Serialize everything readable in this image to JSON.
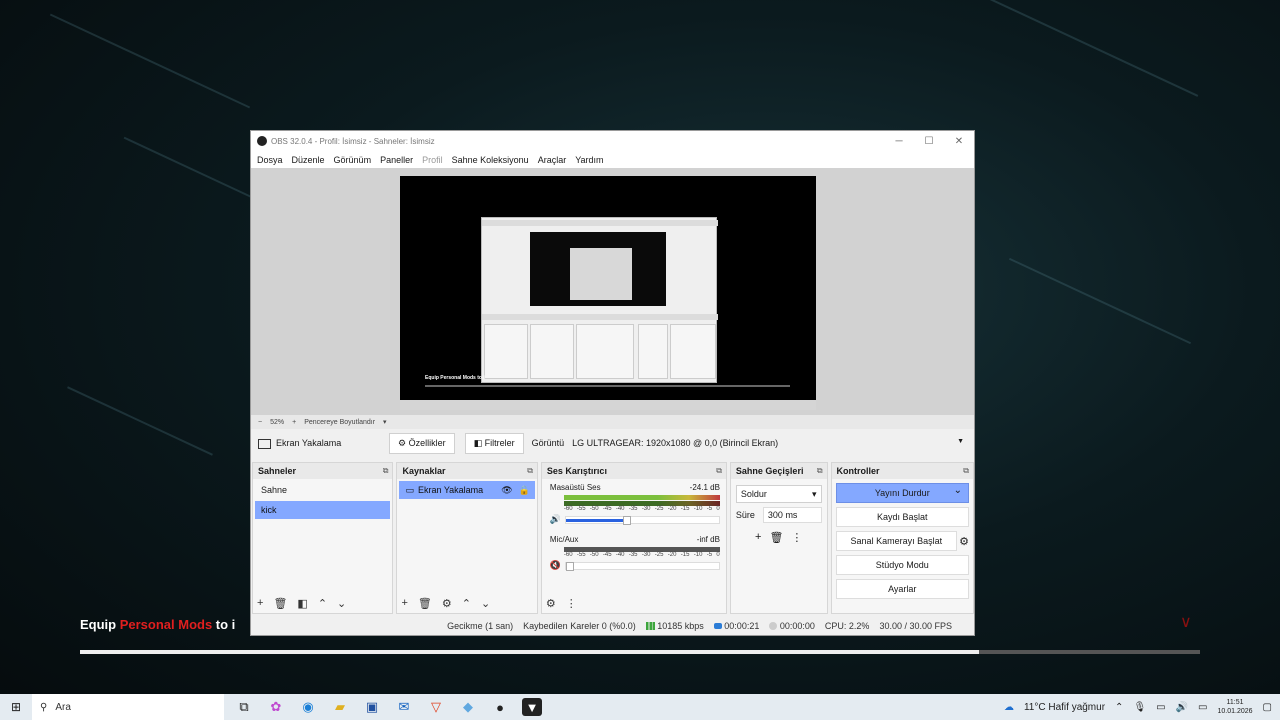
{
  "background": {
    "caption_white": "Equip ",
    "caption_red": "Personal Mods",
    "caption_tail": " to i",
    "progress": 0.803
  },
  "window": {
    "title": "OBS 32.0.4 - Profil: İsimsiz - Sahneler: İsimsiz",
    "controls": {
      "minimize": "─",
      "maximize": "☐",
      "close": "✕"
    }
  },
  "menu": [
    "Dosya",
    "Düzenle",
    "Görünüm",
    "Paneller",
    "Profil",
    "Sahne Koleksiyonu",
    "Araçlar",
    "Yardım"
  ],
  "preview": {
    "zoom_minus": "−",
    "zoom": "52%",
    "zoom_plus": "+",
    "fit": "Pencereye Boyutlandır",
    "fit_arrow": "▾",
    "inner_caption": "Equip Personal Mods to i"
  },
  "source_bar": {
    "label": "Ekran Yakalama",
    "properties": "⚙ Özellikler",
    "filters": "◧ Filtreler",
    "display_label": "Görüntü",
    "display_value": "LG ULTRAGEAR: 1920x1080 @ 0,0 (Birincil Ekran)"
  },
  "docks": {
    "scenes": {
      "title": "Sahneler",
      "items": [
        "Sahne",
        "kick"
      ],
      "selected": "kick"
    },
    "sources": {
      "title": "Kaynaklar",
      "items": [
        "Ekran Yakalama"
      ]
    },
    "mixer": {
      "title": "Ses Karıştırıcı",
      "channels": [
        {
          "name": "Masaüstü Ses",
          "level": "-24.1 dB",
          "volume": 0.4
        },
        {
          "name": "Mic/Aux",
          "level": "-inf dB",
          "volume": 0.0
        }
      ],
      "ticks": [
        "-60",
        "-55",
        "-50",
        "-45",
        "-40",
        "-35",
        "-30",
        "-25",
        "-20",
        "-15",
        "-10",
        "-5",
        "0"
      ]
    },
    "transitions": {
      "title": "Sahne Geçişleri",
      "type": "Soldur",
      "duration_label": "Süre",
      "duration": "300 ms"
    },
    "controls": {
      "title": "Kontroller",
      "buttons": [
        "Yayını Durdur",
        "Kaydı Başlat",
        "Sanal Kamerayı Başlat",
        "Stüdyo Modu",
        "Ayarlar"
      ]
    }
  },
  "status": {
    "delay": "Gecikme (1 san)",
    "dropped": "Kaybedilen Kareler 0 (%0.0)",
    "bitrate": "10185 kbps",
    "stream_time": "00:00:21",
    "rec_time": "00:00:00",
    "cpu": "CPU: 2.2%",
    "fps": "30.00 / 30.00 FPS"
  },
  "taskbar": {
    "search_placeholder": "Ara",
    "weather": "11°C  Hafif yağmur",
    "time": "11:51",
    "date": "10.01.2026"
  },
  "colors": {
    "accent": "#84a8ff",
    "meter_green": "#7bbf3c",
    "meter_red": "#c0393f",
    "bitrate_green": "#3da53d"
  }
}
